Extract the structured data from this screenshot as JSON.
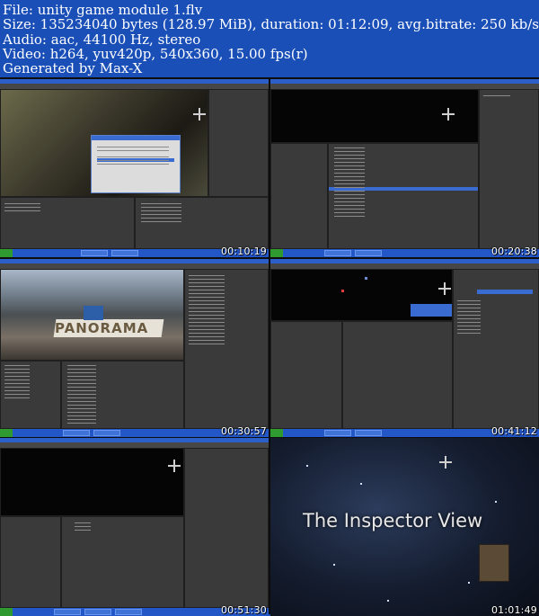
{
  "header": {
    "file": "File: unity game module 1.flv",
    "size": "Size: 135234040 bytes (128.97 MiB), duration: 01:12:09, avg.bitrate: 250 kb/s",
    "audio": "Audio: aac, 44100 Hz, stereo",
    "video": "Video: h264, yuv420p, 540x360, 15.00 fps(r)",
    "generated": "Generated by Max-X"
  },
  "thumbnails": [
    {
      "timestamp": "00:10:19"
    },
    {
      "timestamp": "00:20:38"
    },
    {
      "timestamp": "00:30:57"
    },
    {
      "timestamp": "00:41:12"
    },
    {
      "timestamp": "00:51:30"
    },
    {
      "timestamp": "01:01:49",
      "overlay_text": "The Inspector View"
    }
  ],
  "scene_text": {
    "banner": "PANORAMA"
  },
  "colors": {
    "background": "#1a4fb8",
    "taskbar": "#2356c6",
    "editor": "#2b2b2b"
  }
}
